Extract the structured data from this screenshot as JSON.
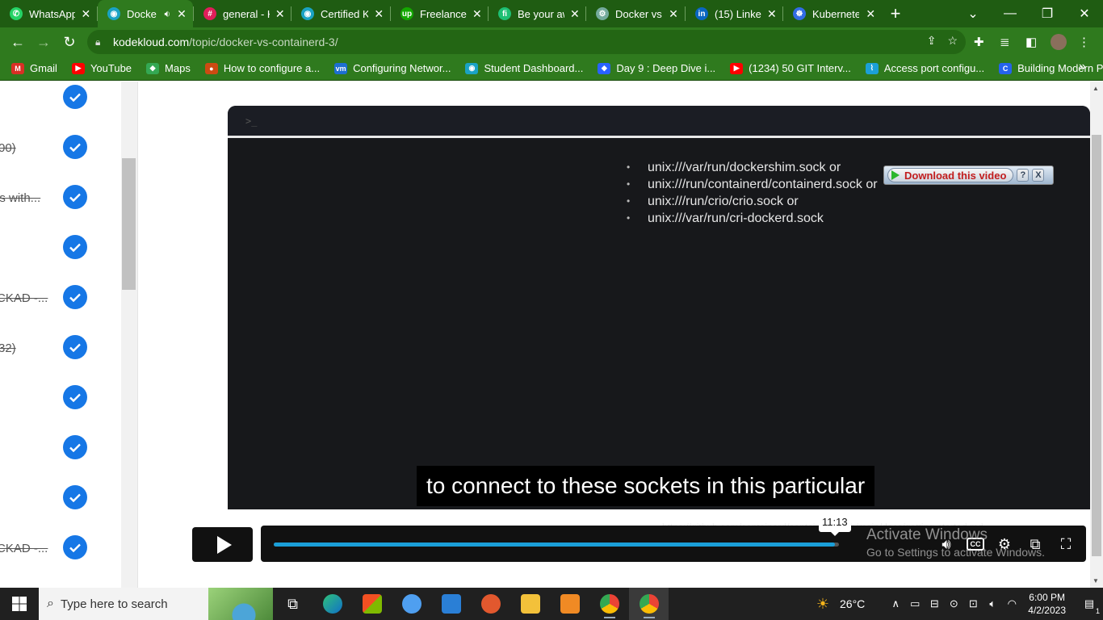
{
  "browser": {
    "tabs": [
      {
        "title": "WhatsApp",
        "color": "#25d366",
        "glyph": "✆"
      },
      {
        "title": "Docke",
        "color": "#1aa3c4",
        "glyph": "◉",
        "active": true,
        "muted_icon": "speaker-icon"
      },
      {
        "title": "general - K",
        "color": "#e01e5a",
        "glyph": "#"
      },
      {
        "title": "Certified K",
        "color": "#1aa3c4",
        "glyph": "◉"
      },
      {
        "title": "Freelance I",
        "color": "#14a800",
        "glyph": "up"
      },
      {
        "title": "Be your aw",
        "color": "#1dbf73",
        "glyph": "fi"
      },
      {
        "title": "Docker vs",
        "color": "#74aa9c",
        "glyph": "⚙"
      },
      {
        "title": "(15) Linked",
        "color": "#0a66c2",
        "glyph": "in"
      },
      {
        "title": "Kubernete",
        "color": "#326ce5",
        "glyph": "☸"
      }
    ],
    "new_tab": "+",
    "url_host": "kodekloud.com",
    "url_path": "/topic/docker-vs-containerd-3/",
    "bookmarks": [
      {
        "label": "Gmail",
        "color": "#d93025",
        "glyph": "M"
      },
      {
        "label": "YouTube",
        "color": "#ff0000",
        "glyph": "▶"
      },
      {
        "label": "Maps",
        "color": "#34a853",
        "glyph": "◆"
      },
      {
        "label": "How to configure a...",
        "color": "#cc4b12",
        "glyph": "●"
      },
      {
        "label": "Configuring Networ...",
        "color": "#1d6fd1",
        "glyph": "vm"
      },
      {
        "label": "Student Dashboard...",
        "color": "#1aa3c4",
        "glyph": "◉"
      },
      {
        "label": "Day 9 : Deep Dive i...",
        "color": "#2962ff",
        "glyph": "◆"
      },
      {
        "label": "(1234) 50 GIT Interv...",
        "color": "#ff0000",
        "glyph": "▶"
      },
      {
        "label": "Access port configu...",
        "color": "#1ba0d7",
        "glyph": "⌇"
      },
      {
        "label": "Building Modern Py...",
        "color": "#2563eb",
        "glyph": "C"
      }
    ],
    "bookmarks_overflow": "»"
  },
  "sidebar": {
    "lessons": [
      {
        "label": ""
      },
      {
        "label": "00)"
      },
      {
        "label": "ls with..."
      },
      {
        "label": ""
      },
      {
        "label": "CKAD -..."
      },
      {
        "label": "32)"
      },
      {
        "label": ""
      },
      {
        "label": ""
      },
      {
        "label": ""
      },
      {
        "label": "CKAD -..."
      }
    ]
  },
  "video": {
    "terminal_prompt": ">_",
    "sockets": [
      "unix:///var/run/dockershim.sock or",
      "unix:///run/containerd/containerd.sock or",
      "unix:///run/crio/crio.sock or",
      "unix:///var/run/cri-dockerd.sock"
    ],
    "download_label": "Download this video",
    "download_help": "?",
    "download_close": "X",
    "caption": "to connect to these sockets in this particular",
    "time_tooltip": "11:13",
    "progress_fraction": 0.993,
    "cc_label": "CC",
    "overlay_url": "https://github.com/containerd/containerd/blob/main/docs/getting-started.md"
  },
  "watermark": {
    "line1": "Activate Windows",
    "line2": "Go to Settings to activate Windows."
  },
  "taskbar": {
    "search_placeholder": "Type here to search",
    "weather": "26°C",
    "time": "6:00 PM",
    "date": "4/2/2023",
    "notification_count": "1"
  },
  "colors": {
    "chrome_frame": "#1f5c12",
    "chrome_toolbar": "#2f7a1e",
    "check_blue": "#1677e6",
    "progress_blue": "#1a9fd8"
  }
}
